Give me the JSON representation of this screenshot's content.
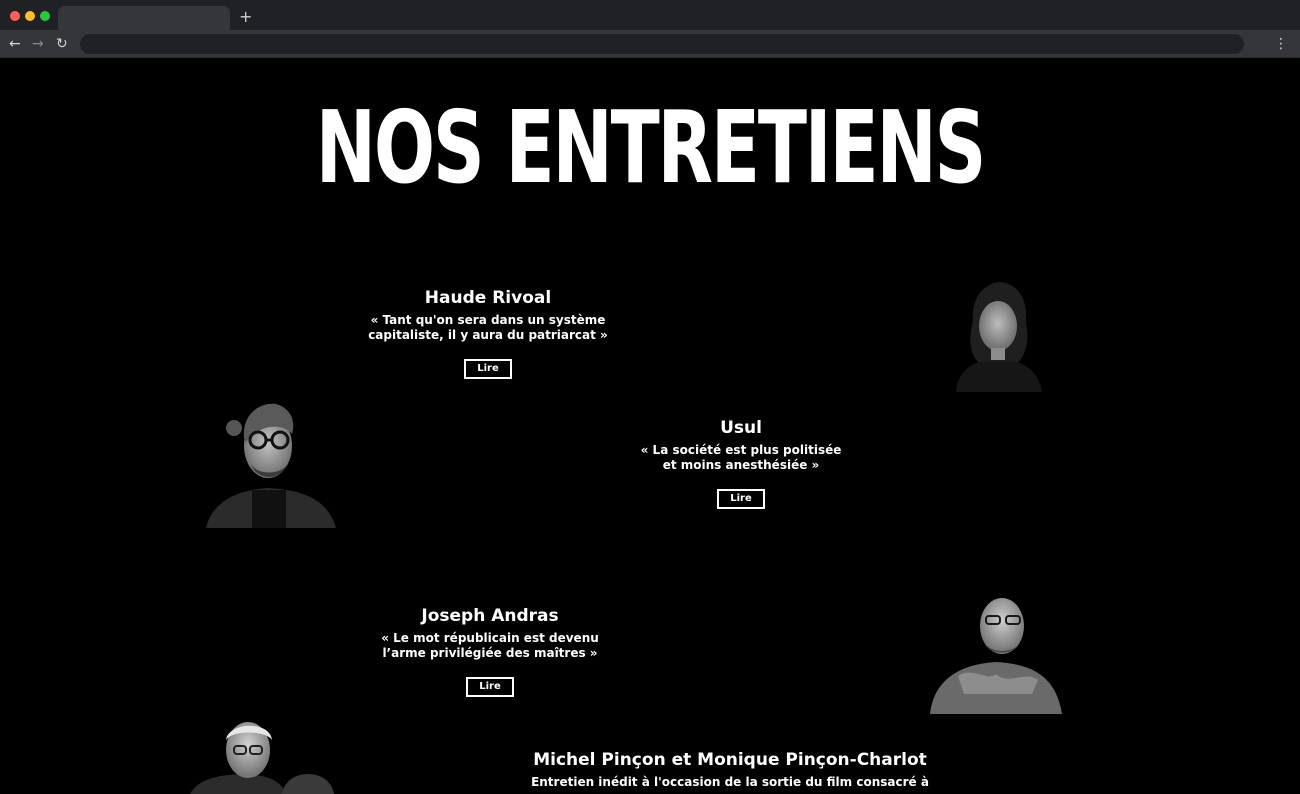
{
  "browser": {
    "new_tab_label": "+",
    "back_icon": "←",
    "forward_icon": "→",
    "reload_icon": "↻",
    "menu_icon": "⋮"
  },
  "page": {
    "title": "NOS ENTRETIENS",
    "entries": [
      {
        "name": "Haude Rivoal",
        "quote": "« Tant qu'on sera dans un système capitaliste, il y aura du patriarcat »",
        "button": "Lire"
      },
      {
        "name": "Usul",
        "quote": "« La société est plus politisée et moins anesthésiée »",
        "button": "Lire"
      },
      {
        "name": "Joseph Andras",
        "quote": "« Le mot républicain est devenu l’arme privilégiée des maîtres »",
        "button": "Lire"
      },
      {
        "name": "Michel Pinçon et Monique Pinçon-Charlot",
        "quote": "Entretien inédit à l'occasion de la sortie du film consacré à"
      }
    ]
  }
}
